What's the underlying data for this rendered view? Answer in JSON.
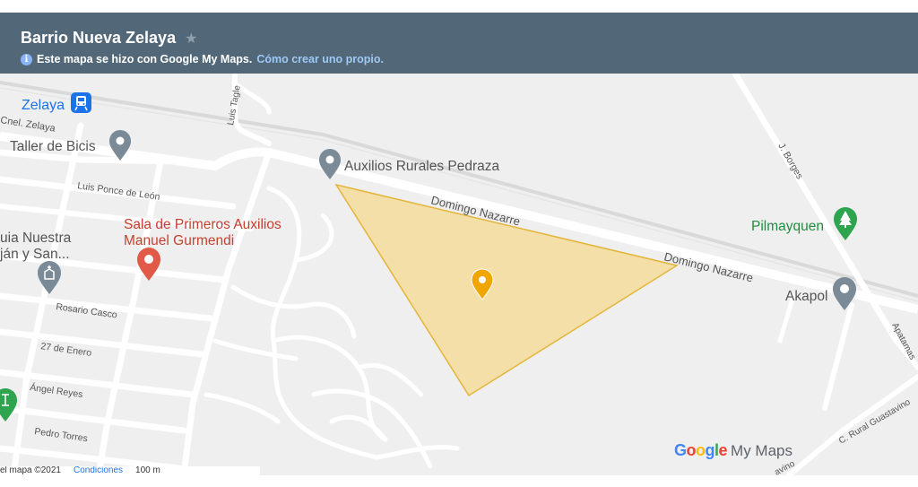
{
  "header": {
    "title": "Barrio Nueva Zelaya",
    "info_text": "Este mapa se hizo con Google My Maps.",
    "info_link": "Cómo crear uno propio."
  },
  "places": {
    "zelaya": "Zelaya",
    "taller": "Taller de Bicis",
    "auxilios_rurales": "Auxilios Rurales Pedraza",
    "sala_line1": "Sala de Primeros Auxilios",
    "sala_line2": "Manuel Gurmendi",
    "guia_line1": "uia Nuestra",
    "guia_line2": "ján y San...",
    "pilmayquen": "Pilmayquen",
    "akapol": "Akapol"
  },
  "streets": {
    "cnel_zelaya": "Cnel. Zelaya",
    "luis_tagle": "Luis Tagle",
    "luis_ponce": "Luis Ponce de León",
    "domingo_1": "Domingo Nazarre",
    "domingo_2": "Domingo Nazarre",
    "j_borges": "J. Borges",
    "rosario_casco": "Rosario Casco",
    "enero": "27 de Enero",
    "angel_reyes": "Ángel Reyes",
    "pedro_torres": "Pedro Torres",
    "apatamas": "Apatamas",
    "rural_guastavino": "C. Rural Guastavino",
    "guastavino_bottom": "avino"
  },
  "footer": {
    "copyright": "el mapa ©2021",
    "terms": "Condiciones",
    "scale": "100 m"
  },
  "brand": {
    "google": "Google",
    "my_maps": "My Maps"
  },
  "colors": {
    "header_bg": "#526879",
    "map_bg": "#f0f0f0",
    "polygon_fill": "#f3dc9a",
    "polygon_stroke": "#e3b53a",
    "pin_gray": "#7a8a97",
    "pin_red": "#e15a47",
    "pin_green": "#2ea44f",
    "pin_yellow": "#f0a500",
    "transit_blue": "#1a73e8",
    "label_gray": "#555555",
    "label_red": "#c5402f",
    "label_green": "#1e8e3e"
  }
}
